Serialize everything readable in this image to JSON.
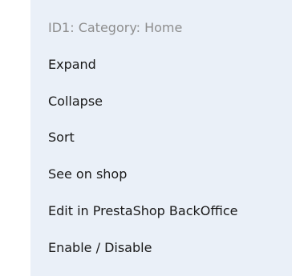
{
  "context_menu": {
    "header": "ID1: Category: Home",
    "items": [
      {
        "label": "Expand"
      },
      {
        "label": "Collapse"
      },
      {
        "label": "Sort"
      },
      {
        "label": "See on shop"
      },
      {
        "label": "Edit in PrestaShop BackOffice"
      },
      {
        "label": "Enable / Disable"
      }
    ]
  },
  "colors": {
    "menu_background": "#eaf0f8",
    "header_text": "#8e8e8e",
    "item_text": "#1a1a1a"
  }
}
